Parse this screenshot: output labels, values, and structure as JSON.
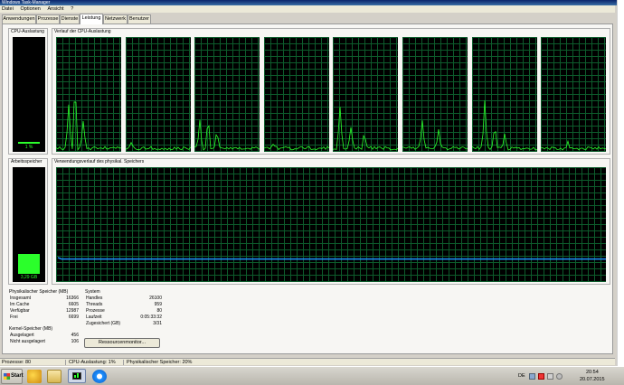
{
  "window": {
    "title": "Windows Task-Manager"
  },
  "menu": [
    "Datei",
    "Optionen",
    "Ansicht",
    "?"
  ],
  "tabs": [
    "Anwendungen",
    "Prozesse",
    "Dienste",
    "Leistung",
    "Netzwerk",
    "Benutzer"
  ],
  "active_tab": "Leistung",
  "cpu": {
    "group_label": "CPU-Auslastung",
    "value_label": "1 %",
    "level_percent": 1,
    "history_label": "Verlauf der CPU-Auslastung",
    "cores": 8
  },
  "memory": {
    "group_label": "Arbeitsspeicher",
    "value_label": "3,29 GB",
    "level_percent": 20,
    "history_label": "Verwendungsverlauf des physikal. Speichers"
  },
  "physical_memory": {
    "title": "Physikalischer Speicher (MB)",
    "rows": [
      {
        "label": "Insgesamt",
        "value": "16366"
      },
      {
        "label": "Im Cache",
        "value": "6605"
      },
      {
        "label": "Verfügbar",
        "value": "12987"
      },
      {
        "label": "Frei",
        "value": "6699"
      }
    ]
  },
  "kernel_memory": {
    "title": "Kernel-Speicher (MB)",
    "rows": [
      {
        "label": "Ausgelagert",
        "value": "456"
      },
      {
        "label": "Nicht ausgelagert",
        "value": "106"
      }
    ]
  },
  "system": {
    "title": "System",
    "rows": [
      {
        "label": "Handles",
        "value": "26100"
      },
      {
        "label": "Threads",
        "value": "959"
      },
      {
        "label": "Prozesse",
        "value": "80"
      },
      {
        "label": "Laufzeit",
        "value": "0:05:33:32"
      },
      {
        "label": "Zugesichert (GB)",
        "value": "3/31"
      }
    ]
  },
  "resource_monitor_button": "Ressourcenmonitor...",
  "statusbar": {
    "processes": "Prozesse: 80",
    "cpu": "CPU-Auslastung: 1%",
    "memory": "Physikalischer Speicher: 20%"
  },
  "taskbar": {
    "start_label": "Start",
    "language": "DE",
    "time": "20:54",
    "date": "20.07.2015"
  },
  "colors": {
    "graph_bg": "#000000",
    "grid": "#0d5c2c",
    "cpu_line": "#2bff2b",
    "memory_line": "#1e90ff"
  }
}
